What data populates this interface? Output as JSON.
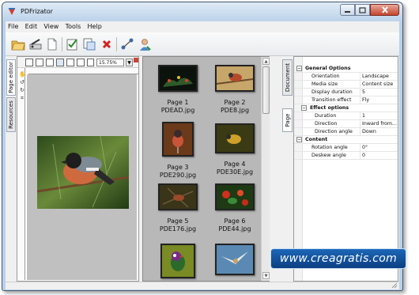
{
  "window": {
    "title": "PDFrizator",
    "accent": "#b9d1ea",
    "close_color": "#c4452f"
  },
  "menu": [
    "File",
    "Edit",
    "View",
    "Tools",
    "Help"
  ],
  "toolbar": {
    "icons": [
      "open-folder-icon",
      "scanner-icon",
      "new-page-icon",
      "properties-icon",
      "export-icon",
      "delete-icon",
      "share-icon",
      "user-icon"
    ]
  },
  "left_tabs": [
    "Page editor",
    "Resources"
  ],
  "page_editor": {
    "zoom": "15.75%",
    "zoom_dropdown_glyph": "▼"
  },
  "thumbnails": [
    {
      "page": "Page 1",
      "file": "PDEAD.jpg"
    },
    {
      "page": "Page 2",
      "file": "PDE8.jpg"
    },
    {
      "page": "Page 3",
      "file": "PDE290.jpg"
    },
    {
      "page": "Page 4",
      "file": "PDE30E.jpg"
    },
    {
      "page": "Page 5",
      "file": "PDE176.jpg"
    },
    {
      "page": "Page 6",
      "file": "PDE44.jpg"
    },
    {
      "page": "",
      "file": ""
    },
    {
      "page": "",
      "file": ""
    }
  ],
  "right_tabs": [
    "Document",
    "Page"
  ],
  "properties": [
    {
      "type": "category",
      "key": "General Options",
      "expander": "−"
    },
    {
      "type": "prop",
      "key": "Orientation",
      "value": "Landscape"
    },
    {
      "type": "prop",
      "key": "Media size",
      "value": "Content size"
    },
    {
      "type": "prop",
      "key": "Display duration",
      "value": "5"
    },
    {
      "type": "prop",
      "key": "Transition effect",
      "value": "Fly"
    },
    {
      "type": "category",
      "key": "Effect options",
      "expander": "−"
    },
    {
      "type": "prop",
      "key": "Duration",
      "value": "1"
    },
    {
      "type": "prop",
      "key": "Direction",
      "value": "Inward from..."
    },
    {
      "type": "prop",
      "key": "Direction angle",
      "value": "Down"
    },
    {
      "type": "category",
      "key": "Content",
      "expander": "−"
    },
    {
      "type": "prop",
      "key": "Rotation angle",
      "value": "0°"
    },
    {
      "type": "prop",
      "key": "Deskew angle",
      "value": "0"
    }
  ],
  "watermark": "www.creagratis.com"
}
